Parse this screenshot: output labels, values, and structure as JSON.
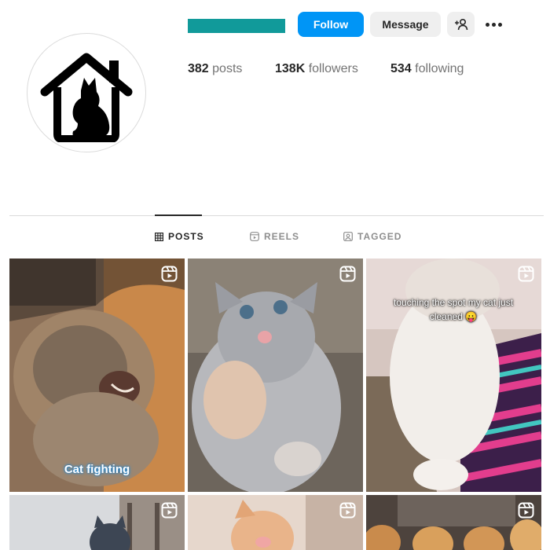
{
  "profile": {
    "follow_label": "Follow",
    "message_label": "Message",
    "stats": {
      "posts_count": "382",
      "posts_label": "posts",
      "followers_count": "138K",
      "followers_label": "followers",
      "following_count": "534",
      "following_label": "following"
    },
    "name_redaction_color": "#119a9a"
  },
  "tabs": [
    {
      "label": "POSTS",
      "icon": "grid-icon",
      "active": true
    },
    {
      "label": "REELS",
      "icon": "reels-icon",
      "active": false
    },
    {
      "label": "TAGGED",
      "icon": "tagged-icon",
      "active": false
    }
  ],
  "posts": [
    {
      "caption": "Cat fighting",
      "icon": "reel-icon",
      "subject": "tabby-cat-hissing"
    },
    {
      "caption": "",
      "icon": "reel-icon",
      "subject": "grey-kitten"
    },
    {
      "caption": "touching the spot my cat just cleaned 😛",
      "icon": "reel-icon",
      "subject": "white-cat-on-striped-blanket"
    },
    {
      "caption": "",
      "icon": "reel-icon",
      "subject": "cat-in-window"
    },
    {
      "caption": "",
      "icon": "reel-icon",
      "subject": "orange-kitten"
    },
    {
      "caption": "",
      "icon": "reel-icon",
      "subject": "golden-puppies"
    }
  ],
  "colors": {
    "accent": "#0095f6",
    "secondary_button": "#efefef",
    "text": "#262626",
    "muted": "#737373"
  }
}
